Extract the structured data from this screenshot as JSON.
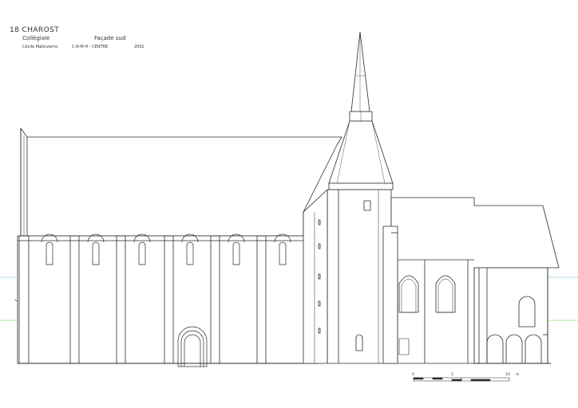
{
  "title_block": {
    "place": "18 CHAROST",
    "building": "Collégiale",
    "view": "Façade sud",
    "author": "Cécile Malinverno",
    "organization": "C-R-M-H - CENTRE",
    "year": "2002"
  },
  "scale_bar": {
    "ticks": [
      "0",
      "5",
      "10"
    ],
    "unit": "m"
  },
  "colors": {
    "line": "#2b2b2b",
    "fine_line": "#555555",
    "guide_blue": "#8fd3ea",
    "guide_green": "#9be07a",
    "background": "#ffffff"
  },
  "icons": {
    "window": "gothic-window-icon",
    "portal": "romanesque-portal-icon"
  }
}
